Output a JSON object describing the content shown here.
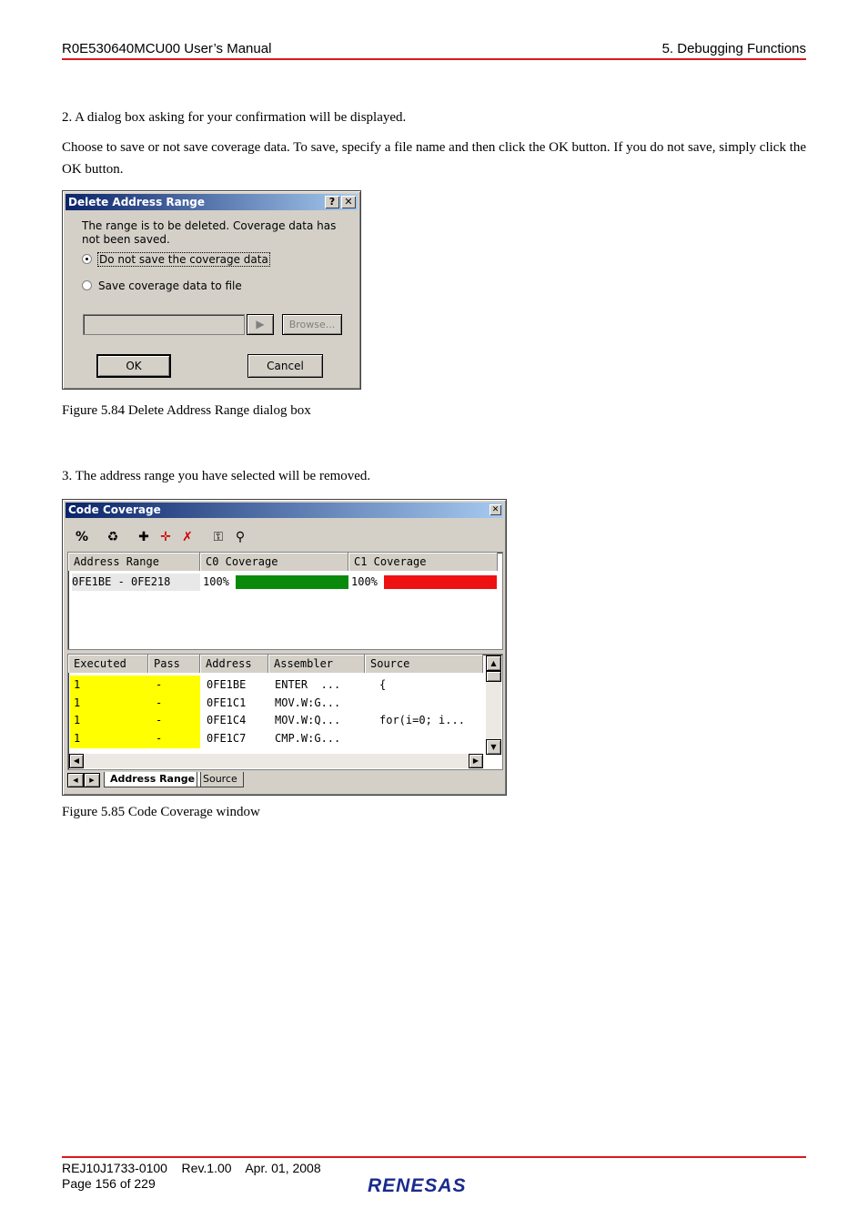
{
  "header": {
    "left": "R0E530640MCU00 User’s Manual",
    "right": "5. Debugging Functions"
  },
  "body": {
    "step2": "2. A dialog box asking for your confirmation will be displayed.",
    "step2_detail": "Choose to save or not save coverage data. To save, specify a file name and then click the OK button. If you do not save, simply click the OK button.",
    "fig84_caption": "Figure 5.84 Delete Address Range dialog box",
    "step3": "3. The address range you have selected will be removed.",
    "fig85_caption": "Figure 5.85 Code Coverage window"
  },
  "dialog": {
    "title": "Delete Address Range",
    "help_glyph": "?",
    "close_glyph": "✕",
    "message": "The range is to be deleted. Coverage data has not been saved.",
    "option1": "Do not save the coverage data",
    "option2": "Save coverage data to file",
    "arrow_glyph": "▶",
    "browse": "Browse...",
    "ok": "OK",
    "cancel": "Cancel"
  },
  "coverage": {
    "title": "Code Coverage",
    "close_glyph": "✕",
    "toolbar_percent": "%",
    "range_headers": [
      "Address Range",
      "C0 Coverage",
      "C1 Coverage"
    ],
    "range_row": {
      "range": "0FE1BE - 0FE218",
      "c0": "100%",
      "c1": "100%",
      "c0_fill": 1.0,
      "c1_fill": 1.0
    },
    "detail_headers": [
      "Executed",
      "Pass",
      "Address",
      "Assembler",
      "Source"
    ],
    "rows": [
      {
        "executed": "1",
        "pass": "-",
        "address": "0FE1BE",
        "assembler": "ENTER  ...",
        "source": "{"
      },
      {
        "executed": "1",
        "pass": "-",
        "address": "0FE1C1",
        "assembler": "MOV.W:G...",
        "source": ""
      },
      {
        "executed": "1",
        "pass": "-",
        "address": "0FE1C4",
        "assembler": "MOV.W:Q...",
        "source": "for(i=0; i..."
      },
      {
        "executed": "1",
        "pass": "-",
        "address": "0FE1C7",
        "assembler": "CMP.W:G...",
        "source": ""
      }
    ],
    "tabs": [
      "Address Range",
      "Source"
    ],
    "colors": {
      "c0_bar": "#0a8a0a",
      "c1_bar": "#ee1111",
      "executed_bg": "#ffff00"
    }
  },
  "footer": {
    "doc": "REJ10J1733-0100",
    "rev": "Rev.1.00",
    "date": "Apr. 01, 2008",
    "page": "Page 156 of 229",
    "logo": "RENESAS"
  }
}
